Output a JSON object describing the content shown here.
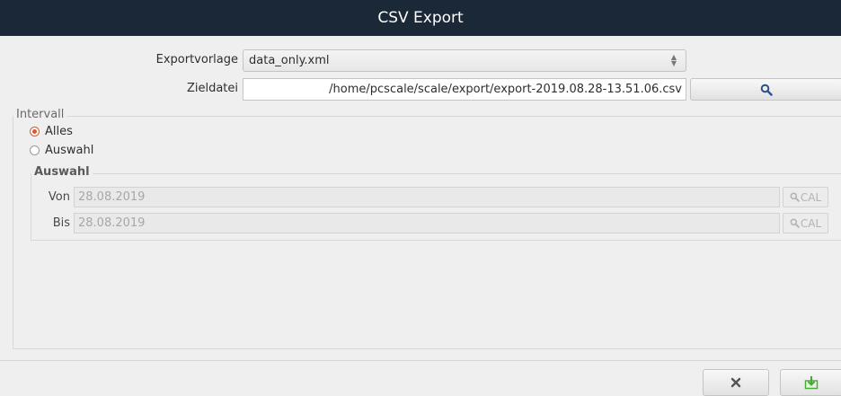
{
  "window": {
    "title": "CSV Export"
  },
  "form": {
    "template_label": "Exportvorlage",
    "template_value": "data_only.xml",
    "target_label": "Zieldatei",
    "target_value": "/home/pcscale/scale/export/export-2019.08.28-13.51.06.csv",
    "browse_icon": "magnifier-icon"
  },
  "interval": {
    "title": "Intervall",
    "options": [
      {
        "label": "Alles",
        "checked": true
      },
      {
        "label": "Auswahl",
        "checked": false
      }
    ],
    "selection": {
      "title": "Auswahl",
      "from_label": "Von",
      "from_value": "28.08.2019",
      "to_label": "Bis",
      "to_value": "28.08.2019",
      "cal_label": "CAL"
    }
  },
  "footer": {
    "cancel_icon": "close-icon",
    "export_icon": "download-icon"
  },
  "colors": {
    "titlebar": "#1b2837",
    "radio_accent": "#e0562b",
    "search_icon": "#2d4f8a",
    "export_icon": "#4aa83a"
  }
}
